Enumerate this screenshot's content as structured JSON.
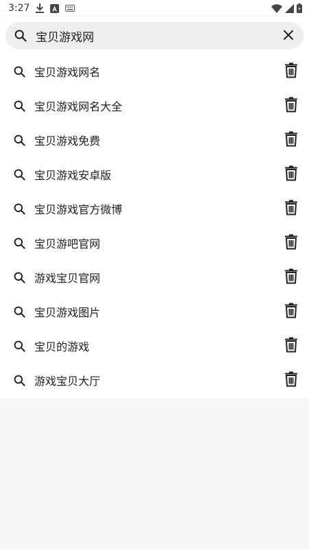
{
  "status_bar": {
    "time": "3:27",
    "icons": [
      "download-icon",
      "a-badge-icon",
      "keyboard-icon",
      "wifi-icon",
      "signal-icon",
      "battery-icon"
    ]
  },
  "search": {
    "value": "宝贝游戏网",
    "placeholder": ""
  },
  "suggestions": [
    {
      "label": "宝贝游戏网名"
    },
    {
      "label": "宝贝游戏网名大全"
    },
    {
      "label": "宝贝游戏免费"
    },
    {
      "label": "宝贝游戏安卓版"
    },
    {
      "label": "宝贝游戏官方微博"
    },
    {
      "label": "宝贝游吧官网"
    },
    {
      "label": "游戏宝贝官网"
    },
    {
      "label": "宝贝游戏图片"
    },
    {
      "label": "宝贝的游戏"
    },
    {
      "label": "游戏宝贝大厅"
    }
  ],
  "colors": {
    "panel": "#ffffff",
    "background": "#f7f7f7",
    "search_bg": "#eeeeef",
    "text": "#202124"
  }
}
